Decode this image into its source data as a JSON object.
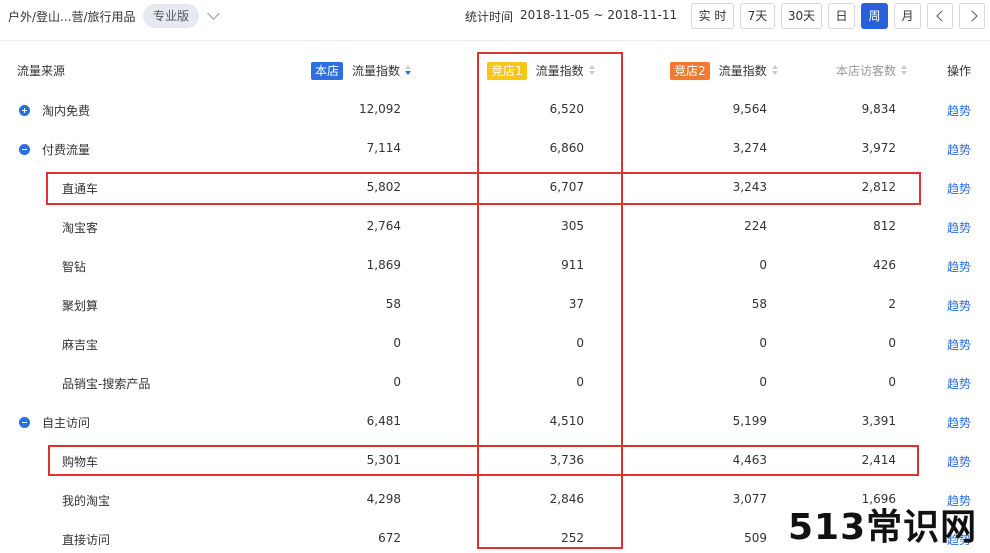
{
  "topbar": {
    "breadcrumb": "户外/登山...营/旅行用品",
    "pro_label": "专业版",
    "stat_label": "统计时间",
    "stat_range": "2018-11-05 ~ 2018-11-11",
    "periods": [
      "实 时",
      "7天",
      "30天",
      "日",
      "周",
      "月"
    ],
    "active_period": "周"
  },
  "table": {
    "headers": {
      "source": "流量来源",
      "store_tag": "本店",
      "comp1_tag": "竞店1",
      "comp2_tag": "竞店2",
      "flow_index": "流量指数",
      "visitors": "本店访客数",
      "action": "操作"
    },
    "trend_label": "趋势",
    "rows": [
      {
        "name": "淘内免费",
        "store": "12,092",
        "comp1": "6,520",
        "comp2": "9,564",
        "visitors": "9,834",
        "level": 0,
        "toggle": "plus"
      },
      {
        "name": "付费流量",
        "store": "7,114",
        "comp1": "6,860",
        "comp2": "3,274",
        "visitors": "3,972",
        "level": 0,
        "toggle": "minus"
      },
      {
        "name": "直通车",
        "store": "5,802",
        "comp1": "6,707",
        "comp2": "3,243",
        "visitors": "2,812",
        "level": 1
      },
      {
        "name": "淘宝客",
        "store": "2,764",
        "comp1": "305",
        "comp2": "224",
        "visitors": "812",
        "level": 1
      },
      {
        "name": "智钻",
        "store": "1,869",
        "comp1": "911",
        "comp2": "0",
        "visitors": "426",
        "level": 1
      },
      {
        "name": "聚划算",
        "store": "58",
        "comp1": "37",
        "comp2": "58",
        "visitors": "2",
        "level": 1
      },
      {
        "name": "麻吉宝",
        "store": "0",
        "comp1": "0",
        "comp2": "0",
        "visitors": "0",
        "level": 1
      },
      {
        "name": "品销宝-搜索产品",
        "store": "0",
        "comp1": "0",
        "comp2": "0",
        "visitors": "0",
        "level": 1
      },
      {
        "name": "自主访问",
        "store": "6,481",
        "comp1": "4,510",
        "comp2": "5,199",
        "visitors": "3,391",
        "level": 0,
        "toggle": "minus"
      },
      {
        "name": "购物车",
        "store": "5,301",
        "comp1": "3,736",
        "comp2": "4,463",
        "visitors": "2,414",
        "level": 1
      },
      {
        "name": "我的淘宝",
        "store": "4,298",
        "comp1": "2,846",
        "comp2": "3,077",
        "visitors": "1,696",
        "level": 1
      },
      {
        "name": "直接访问",
        "store": "672",
        "comp1": "252",
        "comp2": "509",
        "visitors": "",
        "level": 1
      }
    ]
  },
  "watermark": {
    "text": "513常识网"
  },
  "colors": {
    "accent": "#2b6fe0",
    "highlight": "#e03232",
    "comp1_tag": "#f5c518",
    "comp2_tag": "#f07a2f"
  }
}
